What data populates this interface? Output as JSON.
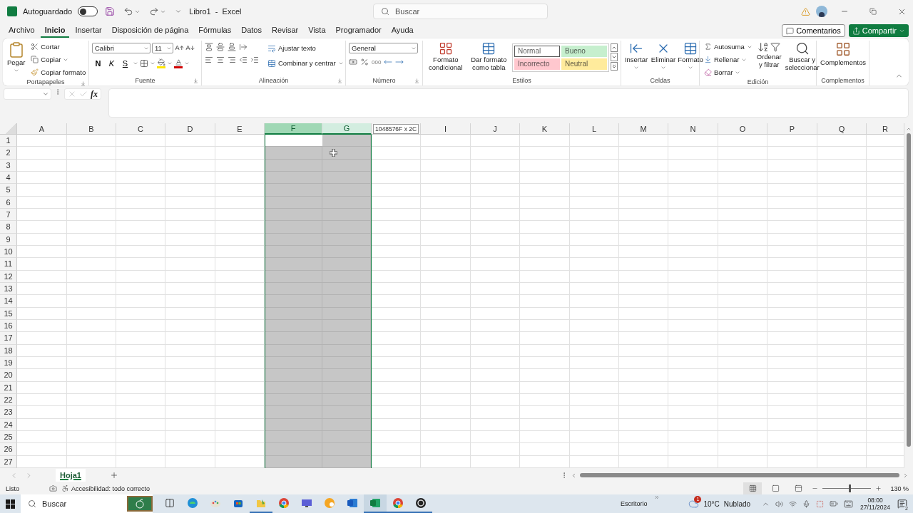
{
  "title_bar": {
    "autosave_label": "Autoguardado",
    "autosave_on": false,
    "document_title": "Libro1  -  Excel",
    "search_placeholder": "Buscar"
  },
  "menu_tabs": [
    {
      "label": "Archivo",
      "selected": false
    },
    {
      "label": "Inicio",
      "selected": true
    },
    {
      "label": "Insertar",
      "selected": false
    },
    {
      "label": "Disposición de página",
      "selected": false
    },
    {
      "label": "Fórmulas",
      "selected": false
    },
    {
      "label": "Datos",
      "selected": false
    },
    {
      "label": "Revisar",
      "selected": false
    },
    {
      "label": "Vista",
      "selected": false
    },
    {
      "label": "Programador",
      "selected": false
    },
    {
      "label": "Ayuda",
      "selected": false
    }
  ],
  "header_buttons": {
    "comments": "Comentarios",
    "share": "Compartir"
  },
  "ribbon": {
    "clipboard": {
      "paste": "Pegar",
      "cut": "Cortar",
      "copy": "Copiar",
      "format_painter": "Copiar formato",
      "label": "Portapapeles"
    },
    "font": {
      "font_name": "Calibri",
      "font_size": "11",
      "bold": "N",
      "italic": "K",
      "underline": "S",
      "label": "Fuente"
    },
    "alignment": {
      "wrap_text": "Ajustar texto",
      "merge_center": "Combinar y centrar",
      "label": "Alineación"
    },
    "number": {
      "format": "General",
      "thousands": "000",
      "label": "Número"
    },
    "styles": {
      "conditional_format": "Formato condicional",
      "format_as_table": "Dar formato como tabla",
      "label": "Estilos",
      "cell_styles": [
        {
          "label": "Normal",
          "color": "#ffffff"
        },
        {
          "label": "Bueno",
          "color": "#c6efce"
        },
        {
          "label": "Incorrecto",
          "color": "#ffc7ce"
        },
        {
          "label": "Neutral",
          "color": "#ffeb9c"
        }
      ]
    },
    "cells": {
      "buttons": [
        "Insertar",
        "Eliminar",
        "Formato"
      ],
      "label": "Celdas"
    },
    "editing": {
      "autosum": "Autosuma",
      "fill": "Rellenar",
      "clear": "Borrar",
      "sort_filter": "Ordenar y filtrar",
      "find_select": "Buscar y seleccionar",
      "label": "Edición"
    },
    "addins": {
      "button": "Complementos",
      "label": "Complementos"
    }
  },
  "formula_bar": {
    "fx": "fx"
  },
  "sheet": {
    "selection_tooltip": "1048576F x 2C",
    "columns": [
      {
        "label": "A",
        "selected": false,
        "active": false
      },
      {
        "label": "B",
        "selected": false,
        "active": false
      },
      {
        "label": "C",
        "selected": false,
        "active": false
      },
      {
        "label": "D",
        "selected": false,
        "active": false
      },
      {
        "label": "E",
        "selected": false,
        "active": false
      },
      {
        "label": "F",
        "selected": true,
        "active": true
      },
      {
        "label": "G",
        "selected": true,
        "active": false
      },
      {
        "selected": false,
        "active": false
      },
      {
        "label": "I",
        "selected": false,
        "active": false
      },
      {
        "label": "J",
        "selected": false,
        "active": false
      },
      {
        "label": "K",
        "selected": false,
        "active": false
      },
      {
        "label": "L",
        "selected": false,
        "active": false
      },
      {
        "label": "M",
        "selected": false,
        "active": false
      },
      {
        "label": "N",
        "selected": false,
        "active": false
      },
      {
        "label": "O",
        "selected": false,
        "active": false
      },
      {
        "label": "P",
        "selected": false,
        "active": false
      },
      {
        "label": "Q",
        "selected": false,
        "active": false
      },
      {
        "label": "R",
        "selected": false,
        "active": false
      }
    ],
    "rows": [
      "1",
      "2",
      "3",
      "4",
      "5",
      "6",
      "7",
      "8",
      "9",
      "10",
      "11",
      "12",
      "13",
      "14",
      "15",
      "16",
      "17",
      "18",
      "19",
      "20",
      "21",
      "22",
      "23",
      "24",
      "25",
      "26",
      "27"
    ]
  },
  "sheet_tabs": [
    {
      "label": "Hoja1",
      "selected": true
    }
  ],
  "status_bar": {
    "status": "Listo",
    "accessibility": "Accesibilidad: todo correcto",
    "zoom": "130 %",
    "zoom_slider": {
      "level": 0.55
    }
  },
  "taskbar": {
    "search_placeholder": "Buscar",
    "desktop_label": "Escritorio",
    "weather": {
      "badge": "1",
      "temperature": "10°C",
      "condition": "Nublado"
    },
    "clock": {
      "time": "08:00",
      "date": "27/11/2024"
    },
    "notifications": "2",
    "apps": [
      {
        "kind": "task_view",
        "running": false,
        "selected": false
      },
      {
        "kind": "edge",
        "running": false,
        "selected": false
      },
      {
        "kind": "paint",
        "running": false,
        "selected": false
      },
      {
        "kind": "store",
        "running": false,
        "selected": false
      },
      {
        "kind": "files",
        "running": true,
        "selected": false
      },
      {
        "kind": "chrome",
        "running": false,
        "selected": false
      },
      {
        "kind": "display",
        "running": false,
        "selected": false
      },
      {
        "kind": "orange",
        "running": false,
        "selected": false
      },
      {
        "kind": "word",
        "running": false,
        "selected": false
      },
      {
        "kind": "excel",
        "running": true,
        "selected": true
      },
      {
        "kind": "chrome",
        "running": true,
        "selected": false
      },
      {
        "kind": "obs",
        "running": true,
        "selected": false
      }
    ]
  }
}
